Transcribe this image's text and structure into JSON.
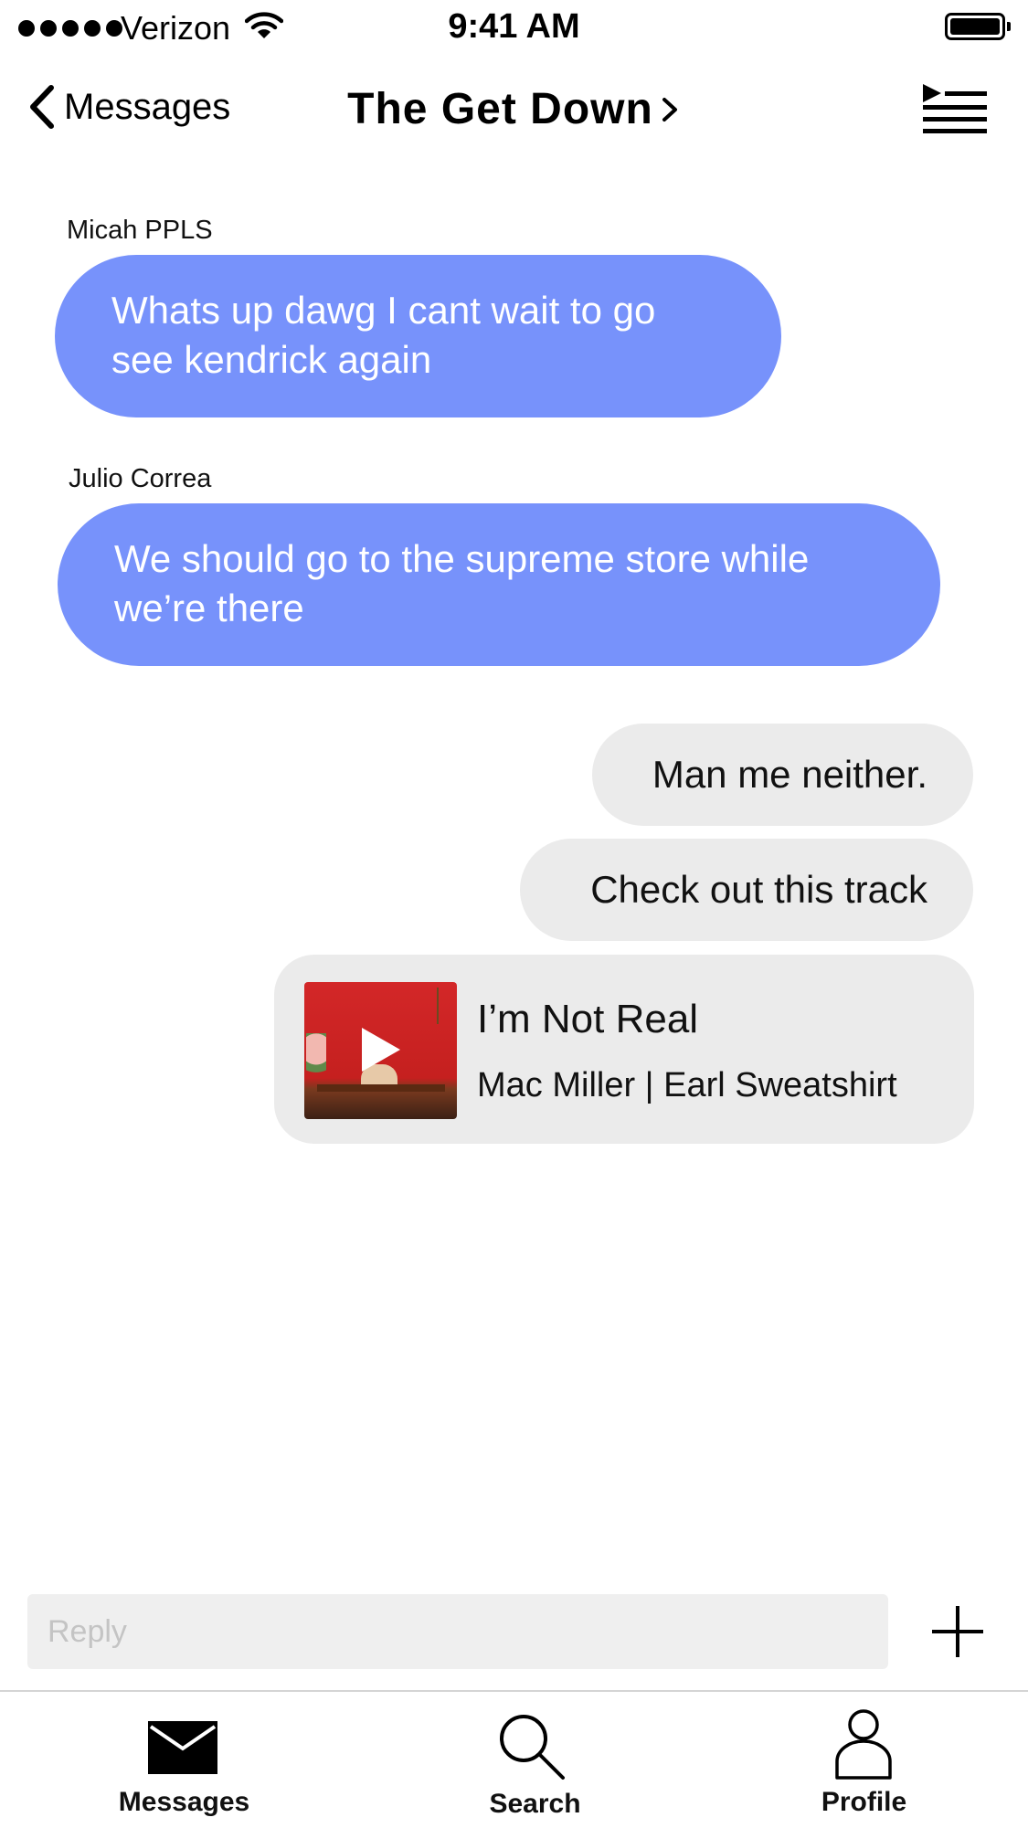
{
  "status_bar": {
    "carrier": "Verizon",
    "time": "9:41 AM"
  },
  "nav": {
    "back_label": "Messages",
    "title": "The Get Down"
  },
  "messages": [
    {
      "sender": "Micah PPLS",
      "text_lines": [
        "Whats up dawg I cant wait to go",
        "see kendrick again"
      ]
    },
    {
      "sender": "Julio Correa",
      "text_lines": [
        "We should go to the supreme store while",
        "we’re there"
      ]
    }
  ],
  "outgoing": [
    "Man me neither.",
    "Check out this track"
  ],
  "track": {
    "title": "I’m Not Real",
    "artist": "Mac Miller | Earl Sweatshirt"
  },
  "reply": {
    "placeholder": "Reply"
  },
  "tabs": [
    {
      "label": "Messages",
      "icon": "envelope-icon"
    },
    {
      "label": "Search",
      "icon": "magnifier-icon"
    },
    {
      "label": "Profile",
      "icon": "person-icon"
    }
  ],
  "colors": {
    "incoming_bubble": "#7792fb",
    "outgoing_bubble": "#ebebeb",
    "reply_field": "#efefef"
  }
}
